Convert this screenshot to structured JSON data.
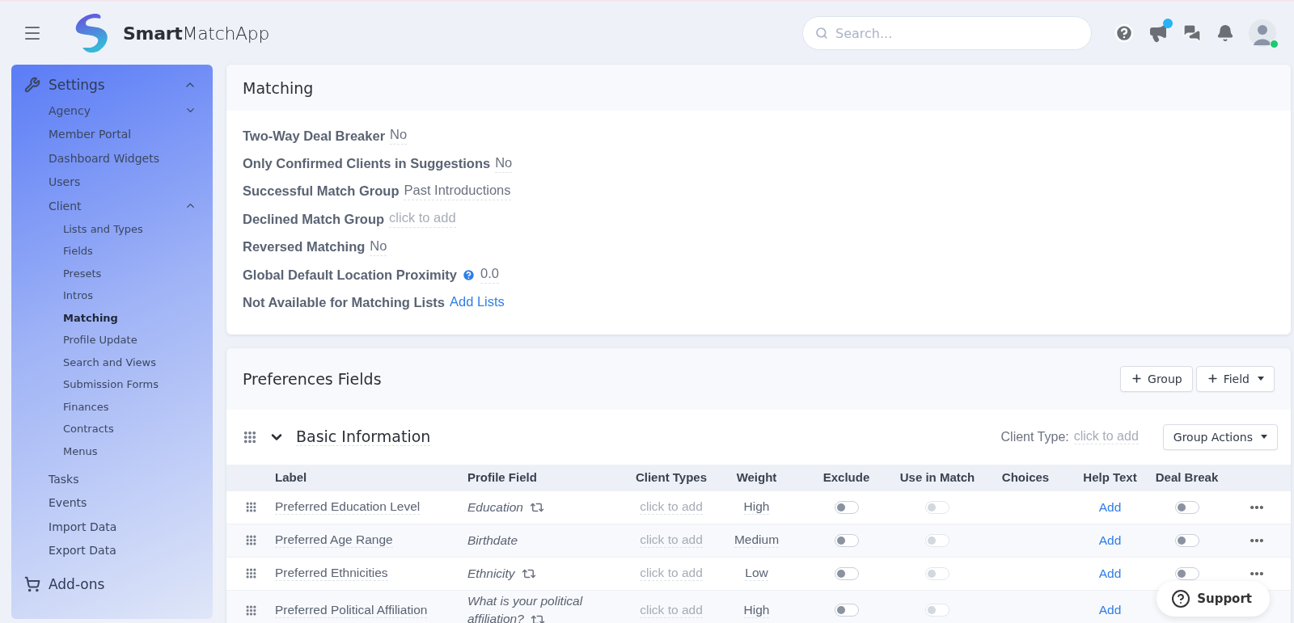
{
  "header": {
    "logo": "**Smart**MatchApp",
    "search": {
      "placeholder": "Search..."
    },
    "announcement_badge": true,
    "user_online": true
  },
  "sidebar": {
    "items": [
      {
        "label": "Settings",
        "expanded": true,
        "selected": false,
        "children": [
          {
            "label": "Agency",
            "expanded": false,
            "selected": false
          },
          {
            "label": "Member Portal",
            "selected": false
          },
          {
            "label": "Dashboard Widgets",
            "selected": false
          },
          {
            "label": "Users",
            "selected": false
          },
          {
            "label": "Client",
            "expanded": true,
            "selected": false,
            "children": [
              {
                "label": "Lists and Types",
                "selected": false
              },
              {
                "label": "Fields",
                "selected": false
              },
              {
                "label": "Presets",
                "selected": false
              },
              {
                "label": "Intros",
                "selected": false
              },
              {
                "label": "Matching",
                "selected": true
              },
              {
                "label": "Profile Update",
                "selected": false
              },
              {
                "label": "Search and Views",
                "selected": false
              },
              {
                "label": "Submission Forms",
                "selected": false
              },
              {
                "label": "Finances",
                "selected": false
              },
              {
                "label": "Contracts",
                "selected": false
              },
              {
                "label": "Menus",
                "selected": false
              }
            ]
          },
          {
            "label": "Tasks",
            "selected": false
          },
          {
            "label": "Events",
            "selected": false
          },
          {
            "label": "Import Data",
            "selected": false
          },
          {
            "label": "Export Data",
            "selected": false
          }
        ]
      },
      {
        "label": "Add-ons",
        "selected": false
      }
    ]
  },
  "matching": {
    "title": "Matching",
    "settings": [
      {
        "label": "Two-Way Deal Breaker",
        "value": "No",
        "kind": "value"
      },
      {
        "label": "Only Confirmed Clients in Suggestions",
        "value": "No",
        "kind": "value"
      },
      {
        "label": "Successful Match Group",
        "value": "Past Introductions",
        "kind": "value"
      },
      {
        "label": "Declined Match Group",
        "value": "click to add",
        "kind": "placeholder"
      },
      {
        "label": "Reversed Matching",
        "value": "No",
        "kind": "value"
      },
      {
        "label": "Global Default Location Proximity",
        "value": "0.0",
        "kind": "value",
        "help": true
      },
      {
        "label": "Not Available for Matching Lists",
        "value": "Add Lists",
        "kind": "link"
      }
    ]
  },
  "preferences": {
    "title": "Preferences Fields",
    "buttons": [
      {
        "label": "Group",
        "dropdown": false
      },
      {
        "label": "Field",
        "dropdown": true
      }
    ],
    "group": {
      "title": "Basic Information",
      "expanded": true,
      "client_type_label": "Client Type:",
      "client_type_value": "click to add",
      "actions": "Group Actions"
    },
    "table": {
      "columns": [
        "Label",
        "Profile Field",
        "Client Types",
        "Weight",
        "Exclude",
        "Use in Match",
        "Choices",
        "Help Text",
        "Deal Break"
      ],
      "rows": [
        {
          "label": "Preferred Education Level",
          "profile_field": "Education",
          "synced": true,
          "client_types": "click to add",
          "weight": "High",
          "exclude": {
            "on": false
          },
          "use_in_match": {
            "on": false,
            "disabled": true
          },
          "help_text": "Add",
          "deal_break": {
            "on": false
          },
          "menu": true
        },
        {
          "label": "Preferred Age Range",
          "profile_field": "Birthdate",
          "synced": false,
          "client_types": "click to add",
          "weight": "Medium",
          "exclude": {
            "on": false
          },
          "use_in_match": {
            "on": false,
            "disabled": true
          },
          "help_text": "Add",
          "deal_break": {
            "on": false
          },
          "menu": true
        },
        {
          "label": "Preferred Ethnicities",
          "profile_field": "Ethnicity",
          "synced": true,
          "client_types": "click to add",
          "weight": "Low",
          "exclude": {
            "on": false
          },
          "use_in_match": {
            "on": false,
            "disabled": true
          },
          "help_text": "Add",
          "deal_break": {
            "on": false
          },
          "menu": true
        },
        {
          "label": "Preferred Political Affiliation",
          "profile_field": "What is your political affiliation?",
          "synced": true,
          "client_types": "click to add",
          "weight": "High",
          "exclude": {
            "on": false
          },
          "use_in_match": {
            "on": false,
            "disabled": true
          },
          "help_text": "Add"
        }
      ]
    }
  },
  "support": {
    "label": "Support"
  }
}
